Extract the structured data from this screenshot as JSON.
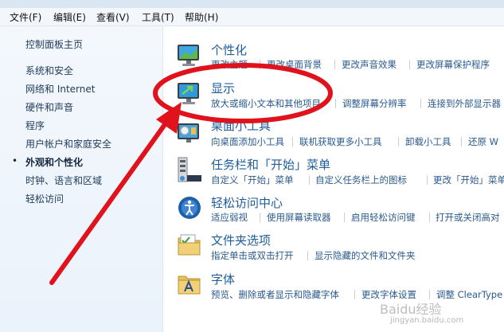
{
  "menu": [
    "文件(F)",
    "编辑(E)",
    "查看(V)",
    "工具(T)",
    "帮助(H)"
  ],
  "sidebar": {
    "home": "控制面板主页",
    "items": [
      "系统和安全",
      "网络和 Internet",
      "硬件和声音",
      "程序",
      "用户帐户和家庭安全",
      "外观和个性化",
      "时钟、语言和区域",
      "轻松访问"
    ],
    "current_index": 5,
    "bullet": "•"
  },
  "categories": [
    {
      "title": "个性化",
      "links": [
        "更改主题",
        "更改桌面背景",
        "更改声音效果",
        "更改屏幕保护程序"
      ]
    },
    {
      "title": "显示",
      "links": [
        "放大或缩小文本和其他项目",
        "调整屏幕分辨率",
        "连接到外部显示器"
      ]
    },
    {
      "title": "桌面小工具",
      "links": [
        "向桌面添加小工具",
        "联机获取更多小工具",
        "卸载小工具",
        "还原 W"
      ]
    },
    {
      "title": "任务栏和「开始」菜单",
      "links": [
        "自定义「开始」菜单",
        "自定义任务栏上的图标",
        "更改「开始」菜单"
      ]
    },
    {
      "title": "轻松访问中心",
      "links": [
        "适应弱视",
        "使用屏幕读取器",
        "启用轻松访问键",
        "打开或关闭高对"
      ]
    },
    {
      "title": "文件夹选项",
      "links": [
        "指定单击或双击打开",
        "显示隐藏的文件和文件夹"
      ]
    },
    {
      "title": "字体",
      "links": [
        "预览、删除或者显示和隐藏字体",
        "更改字体设置",
        "调整 ClearType"
      ]
    }
  ],
  "watermark": {
    "brand": "Baidu经验",
    "url": "jingyan.baidu.com"
  },
  "colors": {
    "annotation": "#e0121b",
    "link": "#2a5a8e",
    "title": "#1e5d9b",
    "sidebar_bg": "#eaf2fb"
  },
  "icons": [
    "monitor-personalize-icon",
    "monitor-display-icon",
    "gadgets-icon",
    "taskbar-icon",
    "ease-of-access-icon",
    "folder-options-icon",
    "fonts-icon"
  ]
}
